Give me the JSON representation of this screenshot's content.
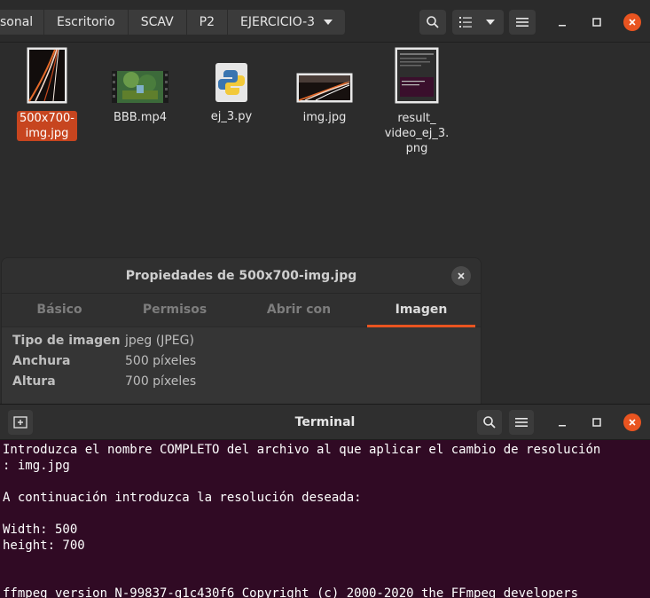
{
  "file_manager": {
    "breadcrumbs": [
      "sonal",
      "Escritorio",
      "SCAV",
      "P2",
      "EJERCICIO-3"
    ],
    "files": [
      {
        "name": "500x700-img.jpg",
        "line1": "500x700-",
        "line2": "img.jpg",
        "selected": true
      },
      {
        "name": "BBB.mp4",
        "line1": "BBB.mp4"
      },
      {
        "name": "ej_3.py",
        "line1": "ej_3.py"
      },
      {
        "name": "img.jpg",
        "line1": "img.jpg"
      },
      {
        "name": "result_video_ej_3.png",
        "line1": "result_",
        "line2": "video_ej_3.",
        "line3": "png"
      }
    ],
    "icons": [
      "search-icon",
      "list-view-icon",
      "chevron-down-icon",
      "hamburger-menu-icon",
      "minimize-icon",
      "maximize-icon",
      "close-icon"
    ]
  },
  "properties": {
    "title": "Propiedades de 500x700-img.jpg",
    "tabs": [
      "Básico",
      "Permisos",
      "Abrir con",
      "Imagen"
    ],
    "active_tab": "Imagen",
    "rows": [
      {
        "label": "Tipo de imagen",
        "value": "jpeg (JPEG)"
      },
      {
        "label": "Anchura",
        "value": "500 píxeles"
      },
      {
        "label": "Altura",
        "value": "700 píxeles"
      }
    ]
  },
  "terminal": {
    "title": "Terminal",
    "lines": [
      "Introduzca el nombre COMPLETO del archivo al que aplicar el cambio de resolución",
      ": img.jpg",
      "",
      "A continuación introduzca la resolución deseada:",
      "",
      "Width: 500",
      "height: 700",
      "",
      "",
      "ffmpeg version N-99837-g1c430f6 Copyright (c) 2000-2020 the FFmpeg developers"
    ]
  },
  "colors": {
    "accent": "#e95420",
    "terminal_bg": "#300a24",
    "window_bg": "#2c2c2c"
  }
}
